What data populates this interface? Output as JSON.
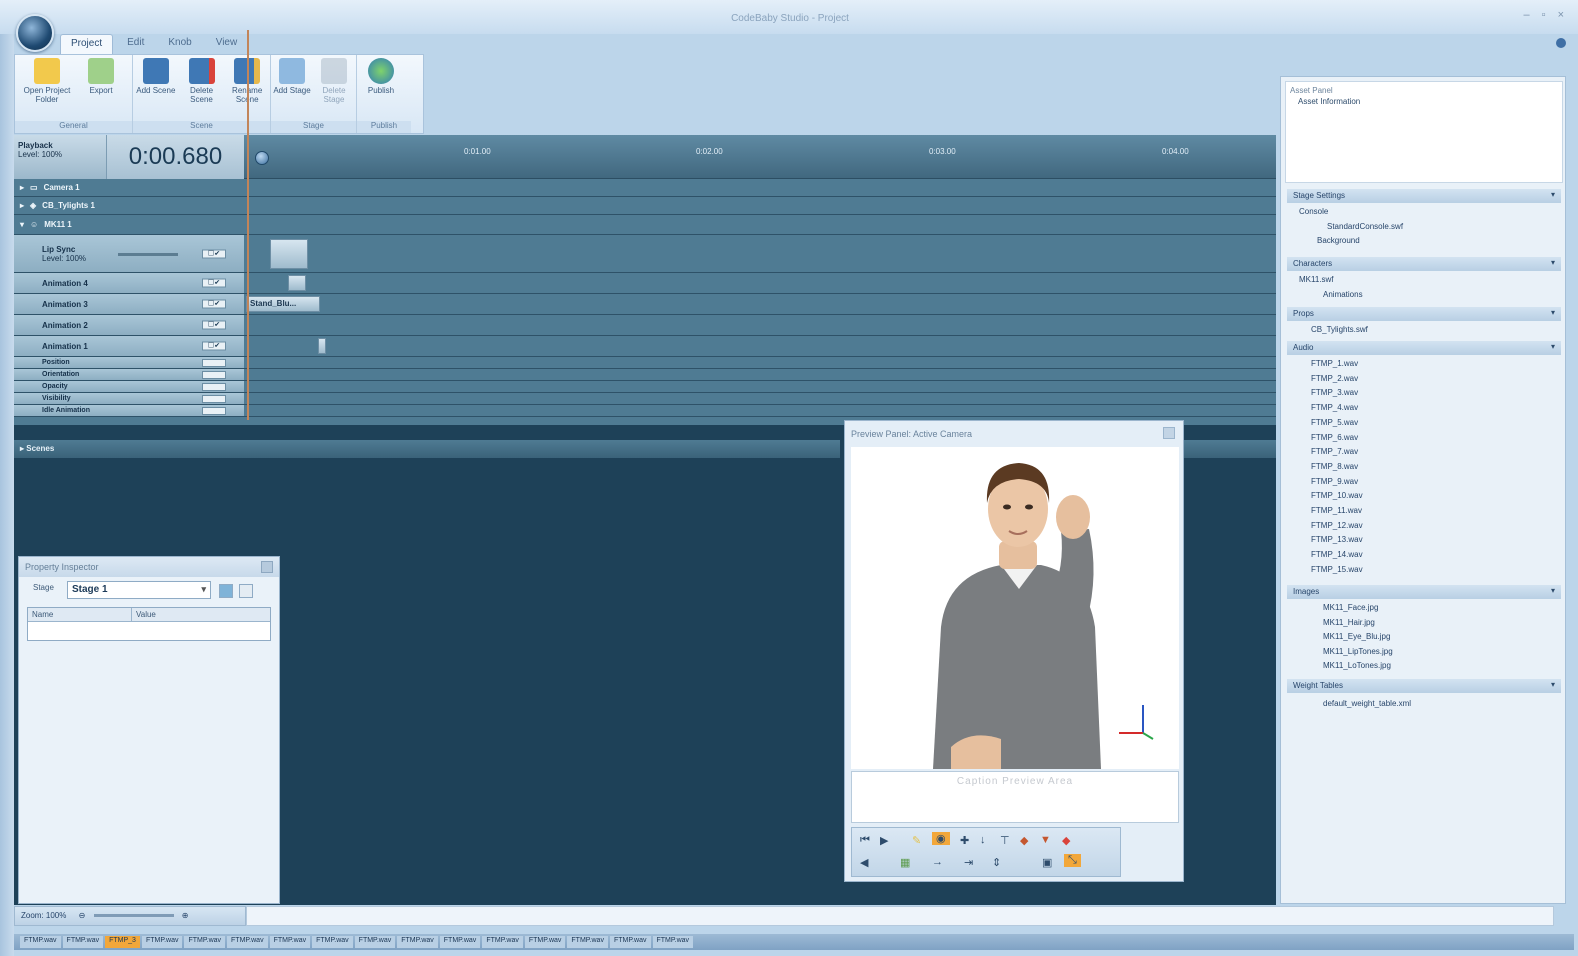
{
  "window": {
    "title": "CodeBaby Studio - Project"
  },
  "ribbon": {
    "tabs": [
      "Project",
      "Edit",
      "Knob",
      "View"
    ],
    "groups": [
      {
        "label": "General",
        "buttons": [
          "Open Project Folder",
          "Export"
        ]
      },
      {
        "label": "Scene",
        "buttons": [
          "Add Scene",
          "Delete Scene",
          "Rename Scene"
        ]
      },
      {
        "label": "Stage",
        "buttons": [
          "Add Stage",
          "Delete Stage"
        ]
      },
      {
        "label": "Publish",
        "buttons": [
          "Publish"
        ]
      }
    ]
  },
  "timeline": {
    "playback_label": "Playback",
    "playback_level": "Level: 100%",
    "timecode": "0:00.680",
    "ruler_ticks": [
      "0:01.00",
      "0:02.00",
      "0:03.00",
      "0:04.00"
    ],
    "tracks": {
      "camera": "Camera 1",
      "typeface": "CB_Tylights 1",
      "char": "MK11 1",
      "lipsync_title": "Lip Sync",
      "lipsync_level": "Level: 100%",
      "anim4": "Animation 4",
      "anim3": "Animation 3",
      "anim2": "Animation 2",
      "anim1": "Animation 1",
      "position": "Position",
      "orientation": "Orientation",
      "opacity": "Opacity",
      "visibility": "Visibility",
      "idle": "Idle Animation",
      "clip3": "Stand_Blu..."
    },
    "scenes_label": "Scenes"
  },
  "property_inspector": {
    "title": "Property Inspector",
    "label": "Stage",
    "stage_value": "Stage 1",
    "col_name": "Name",
    "col_value": "Value"
  },
  "preview": {
    "title": "Preview Panel: Active Camera",
    "caption_placeholder": "Caption Preview Area"
  },
  "asset_panel": {
    "title": "Asset Panel",
    "info_title": "Asset Information",
    "stage_settings": {
      "title": "Stage Settings",
      "items": [
        "Console",
        "StandardConsole.swf",
        "Background"
      ]
    },
    "characters": {
      "title": "Characters",
      "items": [
        "MK11.swf",
        "Animations"
      ]
    },
    "props": {
      "title": "Props",
      "items": [
        "CB_Tylights.swf"
      ]
    },
    "audio": {
      "title": "Audio",
      "items": [
        "FTMP_1.wav",
        "FTMP_2.wav",
        "FTMP_3.wav",
        "FTMP_4.wav",
        "FTMP_5.wav",
        "FTMP_6.wav",
        "FTMP_7.wav",
        "FTMP_8.wav",
        "FTMP_9.wav",
        "FTMP_10.wav",
        "FTMP_11.wav",
        "FTMP_12.wav",
        "FTMP_13.wav",
        "FTMP_14.wav",
        "FTMP_15.wav"
      ]
    },
    "images": {
      "title": "Images",
      "items": [
        "MK11_Face.jpg",
        "MK11_Hair.jpg",
        "MK11_Eye_Blu.jpg",
        "MK11_LipTones.jpg",
        "MK11_LoTones.jpg"
      ]
    },
    "weight_tables": {
      "title": "Weight Tables",
      "items": [
        "default_weight_table.xml"
      ]
    }
  },
  "status": {
    "zoom": "Zoom: 100%"
  },
  "taskbar": {
    "items": [
      "FTMP.wav",
      "FTMP.wav",
      "FTMP_3",
      "FTMP.wav",
      "FTMP.wav",
      "FTMP.wav",
      "FTMP.wav",
      "FTMP.wav",
      "FTMP.wav",
      "FTMP.wav",
      "FTMP.wav",
      "FTMP.wav",
      "FTMP.wav",
      "FTMP.wav",
      "FTMP.wav",
      "FTMP.wav"
    ],
    "highlight_index": 2
  },
  "colors": {
    "timeline": "#4f7b93",
    "workspace": "#1e4158",
    "accent": "#f2a73a"
  }
}
